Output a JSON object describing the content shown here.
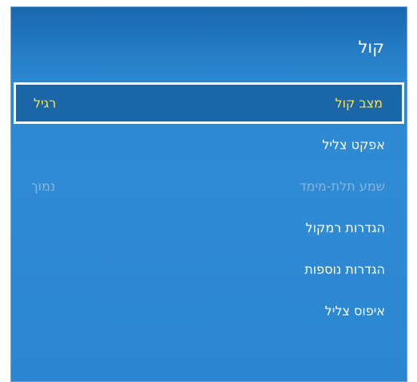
{
  "menu": {
    "title": "קול",
    "items": [
      {
        "label": "מצב קול",
        "value": "רגיל"
      },
      {
        "label": "אפקט צליל",
        "value": ""
      },
      {
        "label": "שמע תלת-מימד",
        "value": "נמוך"
      },
      {
        "label": "הגדרות רמקול",
        "value": ""
      },
      {
        "label": "הגדרות נוספות",
        "value": ""
      },
      {
        "label": "איפוס צליל",
        "value": ""
      }
    ],
    "selected_index": 0,
    "disabled_indices": [
      2
    ]
  },
  "colors": {
    "panel_blue": "#2f8bd3",
    "highlight_yellow": "#ffe14a",
    "disabled_text": "#86b6df"
  }
}
